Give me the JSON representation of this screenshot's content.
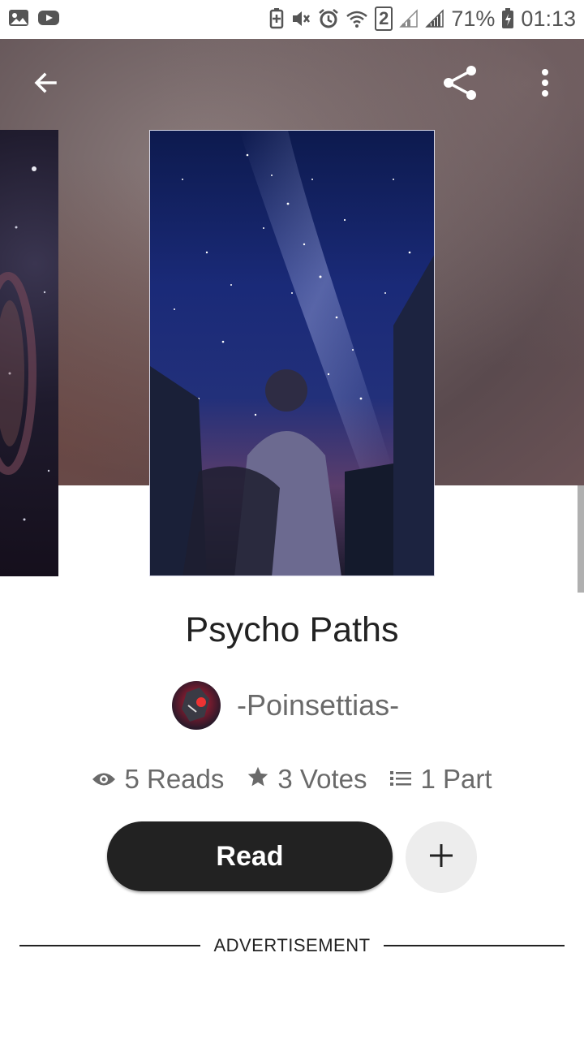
{
  "status_bar": {
    "battery_percent": "71%",
    "time": "01:13",
    "sim_label": "2",
    "icons": [
      "gallery-icon",
      "youtube-icon",
      "battery-saver-icon",
      "mute-icon",
      "alarm-icon",
      "wifi-icon",
      "signal-icon",
      "battery-icon"
    ]
  },
  "header": {
    "icons": [
      "back-arrow-icon",
      "share-icon",
      "more-vertical-icon"
    ]
  },
  "story": {
    "title": "Psycho Paths",
    "author": "-Poinsettias-",
    "reads_label": "5 Reads",
    "votes_label": "3 Votes",
    "parts_label": "1 Part"
  },
  "actions": {
    "read_label": "Read",
    "add_icon": "plus-icon"
  },
  "ad": {
    "label": "ADVERTISEMENT"
  },
  "colors": {
    "read_button_bg": "#222222",
    "add_button_bg": "#ededed",
    "text_muted": "#6a6a6a"
  }
}
